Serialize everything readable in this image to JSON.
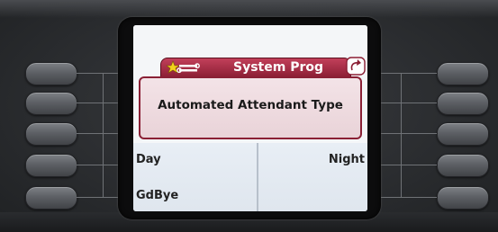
{
  "screen": {
    "title": "System Prog",
    "header": "Automated Attendant Type",
    "softkeys": {
      "left": [
        "Day",
        "GdBye"
      ],
      "right": [
        "Night"
      ]
    }
  },
  "icons": {
    "title_tab_icon": "star-wrench-icon",
    "back_icon": "back-arrow-icon"
  },
  "colors": {
    "accent": "#8b1e34",
    "screen_bg": "#f4f6f8",
    "softkey_bg": "#e3e9f0"
  }
}
